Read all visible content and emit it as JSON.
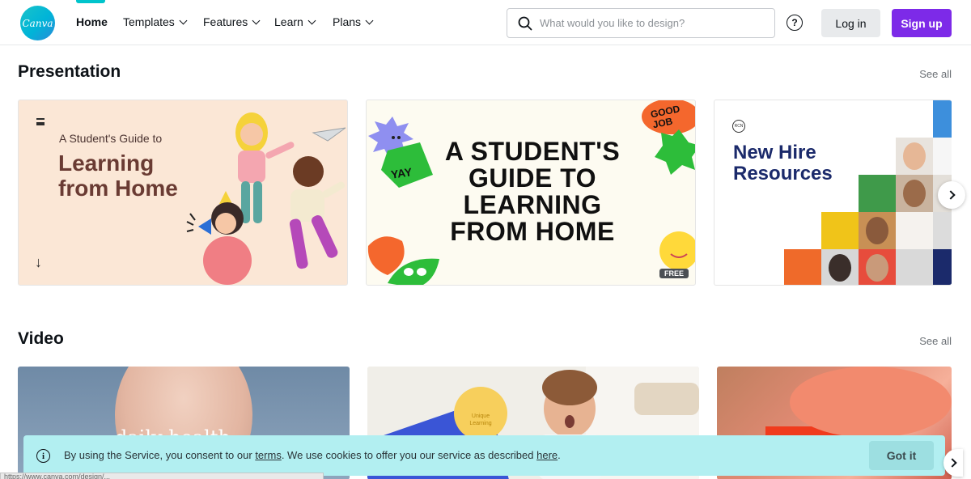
{
  "nav": {
    "logo_text": "Canva",
    "items": [
      {
        "label": "Home",
        "active": true
      },
      {
        "label": "Templates"
      },
      {
        "label": "Features"
      },
      {
        "label": "Learn"
      },
      {
        "label": "Plans"
      }
    ],
    "search_placeholder": "What would you like to design?",
    "help_glyph": "?",
    "login_label": "Log in",
    "signup_label": "Sign up",
    "colors": {
      "accent": "#00c4cc",
      "signup": "#7d2ae8"
    }
  },
  "sections": {
    "presentation": {
      "title": "Presentation",
      "see_all": "See all",
      "cards": [
        {
          "kicker": "A Student's Guide to",
          "title": "Learning from Home",
          "arrow": "↓"
        },
        {
          "stickers": [
            "YAY",
            "GOOD JOB"
          ],
          "title": "A STUDENT'S GUIDE TO LEARNING FROM HOME",
          "badge": "FREE"
        },
        {
          "badge": "RCN",
          "title": "New Hire Resources"
        }
      ]
    },
    "video": {
      "title": "Video",
      "see_all": "See all",
      "cards": [
        {
          "text": "daily health"
        },
        {
          "text": "Unique Learning"
        },
        {}
      ]
    }
  },
  "cookie_banner": {
    "text_before": "By using the Service, you consent to our ",
    "terms_link": "terms",
    "text_middle": ". We use cookies to offer you our service as described ",
    "here_link": "here",
    "text_after": ".",
    "button_label": "Got it",
    "info_glyph": "i"
  },
  "status_url": "https://www.canva.com/design/..."
}
